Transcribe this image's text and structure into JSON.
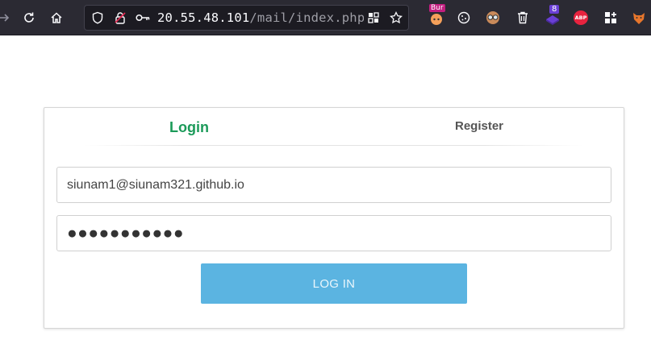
{
  "browser": {
    "url_host": "20.55.48.101",
    "url_path": "/mail/index.php",
    "extension_badges": {
      "burp": "Bur",
      "counter": "8",
      "adblock": "ABP"
    }
  },
  "tabs": {
    "login": "Login",
    "register": "Register"
  },
  "form": {
    "email_value": "siunam1@siunam321.github.io",
    "password_value": "●●●●●●●●●●●",
    "login_button": "LOG IN"
  },
  "colors": {
    "active_tab": "#1b9a59",
    "button": "#5bb4e1",
    "toolbar": "#2b2a33"
  }
}
